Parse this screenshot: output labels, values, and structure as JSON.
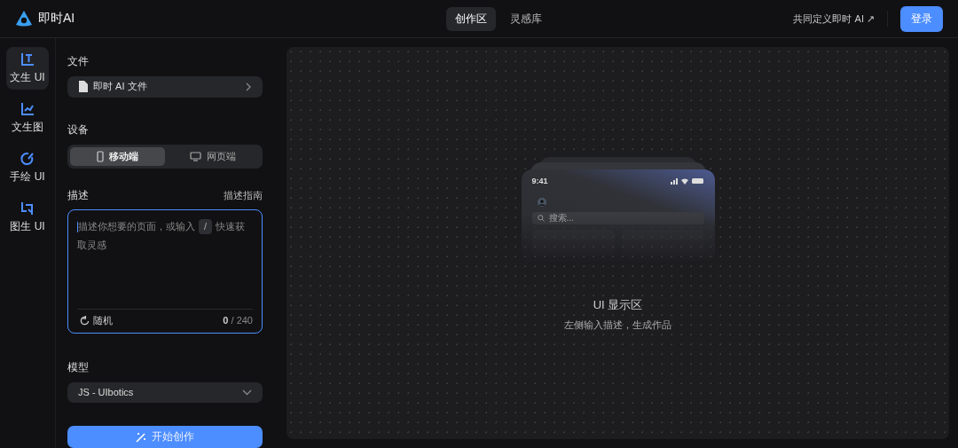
{
  "header": {
    "brand": "即时AI",
    "tabs": [
      {
        "label": "创作区",
        "selected": true
      },
      {
        "label": "灵感库",
        "selected": false
      }
    ],
    "link": "共同定义即时 AI ↗",
    "login": "登录"
  },
  "rail": [
    {
      "label": "文生 UI",
      "kind": "text",
      "selected": true
    },
    {
      "label": "文生图",
      "kind": "chart",
      "selected": false
    },
    {
      "label": "手绘 UI",
      "kind": "draw",
      "selected": false
    },
    {
      "label": "图生 UI",
      "kind": "image",
      "selected": false
    }
  ],
  "file": {
    "heading": "文件",
    "value": "即时 AI 文件"
  },
  "device": {
    "heading": "设备",
    "options": [
      {
        "label": "移动端",
        "kind": "mobile",
        "selected": true
      },
      {
        "label": "网页端",
        "kind": "desktop",
        "selected": false
      }
    ]
  },
  "description": {
    "heading": "描述",
    "guide": "描述指南",
    "hint": "描述你想要的页面，或输入",
    "key": "/",
    "hint_end": "快速获取灵感",
    "random": "随机",
    "count": "0",
    "limit": "/ 240"
  },
  "model": {
    "heading": "模型",
    "value": "JS - UIbotics"
  },
  "start": "开始创作",
  "preview": {
    "time": "9:41",
    "search": "搜索...",
    "title": "UI 显示区",
    "subtitle": "左侧输入描述，生成作品"
  }
}
